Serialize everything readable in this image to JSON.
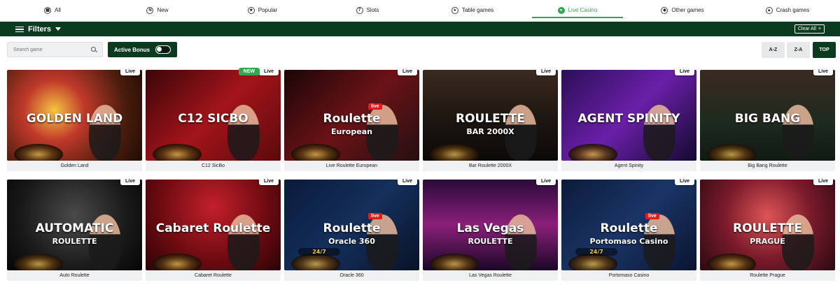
{
  "tabs": [
    {
      "label": "All",
      "icon": "grid-icon",
      "glyph": "▦",
      "active": false
    },
    {
      "label": "New",
      "icon": "new-icon",
      "glyph": "N",
      "active": false
    },
    {
      "label": "Popular",
      "icon": "popular-icon",
      "glyph": "★",
      "active": false
    },
    {
      "label": "Slots",
      "icon": "slots-icon",
      "glyph": "7",
      "active": false
    },
    {
      "label": "Table games",
      "icon": "table-games-icon",
      "glyph": "♠",
      "active": false
    },
    {
      "label": "Live Casino",
      "icon": "live-casino-icon",
      "glyph": "●",
      "active": true
    },
    {
      "label": "Other games",
      "icon": "other-games-icon",
      "glyph": "◆",
      "active": false
    },
    {
      "label": "Crash games",
      "icon": "crash-games-icon",
      "glyph": "▲",
      "active": false
    }
  ],
  "filterbar": {
    "filters_label": "Filters",
    "clear_label": "Clear All",
    "clear_icon": "×"
  },
  "search": {
    "placeholder": "Search game"
  },
  "bonus": {
    "label": "Active Bonus"
  },
  "sort": {
    "az": "A-Z",
    "za": "Z-A",
    "top": "TOP"
  },
  "colors": {
    "accent": "#2fa84f",
    "brand_dark": "#0b3b1f"
  },
  "games": [
    {
      "name": "Golden Land",
      "badge": "Live",
      "new": false,
      "art_title": "GOLDEN LAND",
      "art_sub": "",
      "theme": "gold"
    },
    {
      "name": "C12 SicBo",
      "badge": "Live",
      "new": true,
      "new_label": "NEW",
      "art_title": "C12 SICBO",
      "art_sub": "",
      "theme": "red"
    },
    {
      "name": "Live Roulette European",
      "badge": "Live",
      "new": false,
      "art_title": "Roulette",
      "art_sub": "European",
      "art_pill": "live",
      "theme": "darkred"
    },
    {
      "name": "Bar Roulette 2000X",
      "badge": "Live",
      "new": false,
      "art_title": "ROULETTE",
      "art_sub": "BAR 2000X",
      "theme": "dark"
    },
    {
      "name": "Agent Spinity",
      "badge": "Live",
      "new": false,
      "art_title": "AGENT SPINITY",
      "art_sub": "",
      "theme": "purple"
    },
    {
      "name": "Big Bang Roulette",
      "badge": "Live",
      "new": false,
      "art_title": "BIG BANG",
      "art_sub": "",
      "theme": "casino"
    },
    {
      "name": "Auto Roulette",
      "badge": "Live",
      "new": false,
      "art_title": "AUTOMATIC",
      "art_sub": "ROULETTE",
      "theme": "black"
    },
    {
      "name": "Cabaret Roulette",
      "badge": "Live",
      "new": false,
      "art_title": "Cabaret Roulette",
      "art_sub": "",
      "theme": "cabaret"
    },
    {
      "name": "Oracle 360",
      "badge": "Live",
      "new": false,
      "art_title": "Roulette",
      "art_sub": "Oracle 360",
      "art_extra": "24/7",
      "art_pill": "live",
      "theme": "navy"
    },
    {
      "name": "Las Vegas Roulette",
      "badge": "Live",
      "new": false,
      "art_title": "Las Vegas",
      "art_sub": "ROULETTE",
      "theme": "vegas"
    },
    {
      "name": "Portomaso Casino",
      "badge": "Live",
      "new": false,
      "art_title": "Roulette",
      "art_sub": "Portomaso Casino",
      "art_extra": "24/7",
      "art_pill": "live",
      "theme": "navy2"
    },
    {
      "name": "Roulette Prague",
      "badge": "Live",
      "new": false,
      "art_title": "ROULETTE",
      "art_sub": "PRAGUE",
      "theme": "teal"
    }
  ]
}
